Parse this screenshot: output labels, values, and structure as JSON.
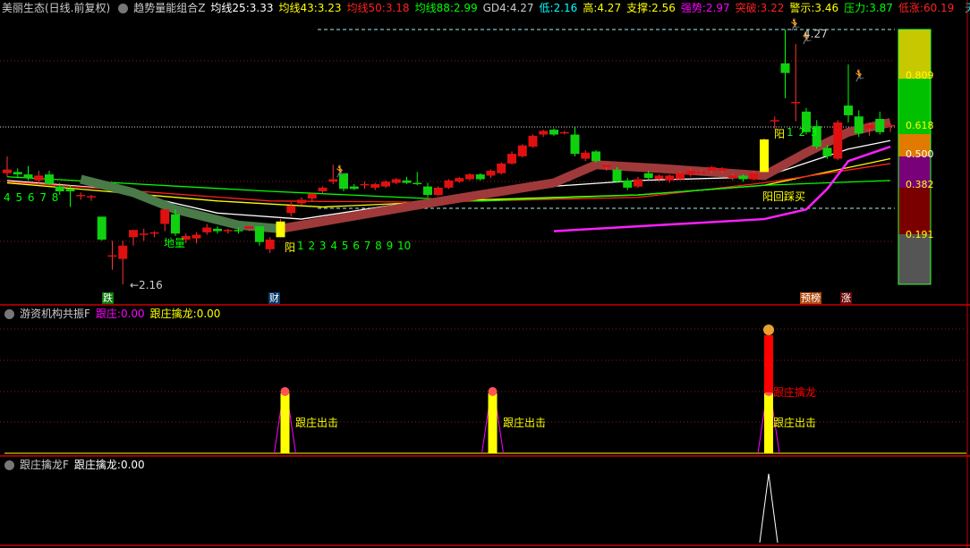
{
  "header": {
    "stock": "美丽生态(日线.前复权)",
    "indicator": "趋势量能组合Z",
    "values": [
      {
        "label": "均线25:",
        "value": "3.33",
        "color": "#ffffff"
      },
      {
        "label": "均线43:",
        "value": "3.23",
        "color": "#ffff00"
      },
      {
        "label": "均线50:",
        "value": "3.18",
        "color": "#ff2020"
      },
      {
        "label": "均线88:",
        "value": "2.99",
        "color": "#00ff00"
      },
      {
        "label": "GD4:",
        "value": "4.27",
        "color": "#cccccc"
      },
      {
        "label": "低:",
        "value": "2.16",
        "color": "#00ffff"
      },
      {
        "label": "高:",
        "value": "4.27",
        "color": "#ffff00"
      },
      {
        "label": "支撑:",
        "value": "2.56",
        "color": "#ffff00"
      },
      {
        "label": "强势:",
        "value": "2.97",
        "color": "#ff00ff"
      },
      {
        "label": "突破:",
        "value": "3.22",
        "color": "#ff2020"
      },
      {
        "label": "警示:",
        "value": "3.46",
        "color": "#ffff00"
      },
      {
        "label": "压力:",
        "value": "3.87",
        "color": "#00ff00"
      },
      {
        "label": "低涨:",
        "value": "60.19",
        "color": "#ff2020"
      }
    ],
    "tail": "天◇"
  },
  "main": {
    "annotations": {
      "high": "4.27",
      "low": "←2.16",
      "diliang": "地量",
      "seq_left": "4 5 6 7 8",
      "yang": "阳",
      "seq_mid": "1 2 3 4 5 6 7 8 9 10",
      "seq_right": "1 2 3",
      "yang_right": "阳",
      "huicai": "阳回踩买"
    },
    "tags": {
      "die": "跌",
      "cai": "财",
      "yubang": "预榜",
      "zhang": "涨"
    },
    "fib_levels": [
      "0.809",
      "0.618",
      "0.500",
      "0.382",
      "0.191"
    ]
  },
  "panel1": {
    "title": "游资机构共振F",
    "v1_label": "跟庄:",
    "v1": "0.00",
    "v2_label": "跟庄擒龙:",
    "v2": "0.00",
    "signal": "跟庄出击",
    "signal2": "跟庄擒龙"
  },
  "panel2": {
    "title": "跟庄擒龙F",
    "v_label": "跟庄擒龙:",
    "v": "0.00"
  },
  "chart_data": {
    "type": "candlestick",
    "ylim": [
      2.16,
      4.27
    ],
    "ohlc": [
      [
        3.08,
        3.22,
        3.05,
        3.11
      ],
      [
        3.09,
        3.12,
        3.04,
        3.07
      ],
      [
        3.07,
        3.14,
        3.02,
        3.04
      ],
      [
        3.02,
        3.1,
        2.99,
        3.06
      ],
      [
        3.07,
        3.1,
        2.98,
        2.99
      ],
      [
        2.97,
        3.0,
        2.9,
        2.93
      ],
      [
        2.95,
        2.98,
        2.8,
        2.93
      ],
      [
        2.9,
        2.92,
        2.86,
        2.9
      ],
      [
        2.88,
        2.9,
        2.85,
        2.89
      ],
      [
        2.72,
        2.72,
        2.52,
        2.53
      ],
      [
        2.39,
        2.52,
        2.28,
        2.4
      ],
      [
        2.37,
        2.52,
        2.16,
        2.48
      ],
      [
        2.55,
        2.6,
        2.48,
        2.61
      ],
      [
        2.58,
        2.62,
        2.52,
        2.58
      ],
      [
        2.58,
        2.6,
        2.55,
        2.59
      ],
      [
        2.66,
        2.77,
        2.6,
        2.78
      ],
      [
        2.74,
        2.78,
        2.56,
        2.58
      ],
      [
        2.53,
        2.58,
        2.5,
        2.56
      ],
      [
        2.54,
        2.59,
        2.5,
        2.57
      ],
      [
        2.59,
        2.66,
        2.57,
        2.63
      ],
      [
        2.62,
        2.64,
        2.58,
        2.6
      ],
      [
        2.6,
        2.62,
        2.58,
        2.61
      ],
      [
        2.61,
        2.63,
        2.58,
        2.6
      ],
      [
        2.62,
        2.65,
        2.6,
        2.64
      ],
      [
        2.64,
        2.64,
        2.48,
        2.51
      ],
      [
        2.45,
        2.55,
        2.42,
        2.53
      ],
      [
        2.55,
        2.7,
        2.55,
        2.68
      ],
      [
        2.75,
        2.84,
        2.72,
        2.81
      ],
      [
        2.83,
        2.88,
        2.82,
        2.86
      ],
      [
        2.87,
        2.92,
        2.85,
        2.91
      ],
      [
        2.93,
        2.97,
        2.91,
        2.96
      ],
      [
        3.01,
        3.15,
        2.99,
        3.03
      ],
      [
        3.08,
        3.08,
        2.93,
        2.95
      ],
      [
        2.97,
        2.99,
        2.94,
        2.95
      ],
      [
        2.99,
        3.01,
        2.95,
        2.99
      ],
      [
        2.96,
        3.0,
        2.94,
        2.99
      ],
      [
        2.97,
        3.02,
        2.96,
        3.01
      ],
      [
        3.0,
        3.04,
        2.99,
        3.03
      ],
      [
        3.02,
        3.05,
        2.99,
        3.0
      ],
      [
        3.0,
        3.09,
        2.98,
        2.99
      ],
      [
        2.97,
        3.0,
        2.88,
        2.9
      ],
      [
        2.9,
        2.97,
        2.89,
        2.96
      ],
      [
        2.96,
        3.03,
        2.95,
        3.02
      ],
      [
        3.01,
        3.05,
        3.0,
        3.04
      ],
      [
        3.03,
        3.08,
        3.02,
        3.07
      ],
      [
        3.07,
        3.08,
        3.02,
        3.03
      ],
      [
        3.06,
        3.11,
        3.04,
        3.1
      ],
      [
        3.08,
        3.17,
        3.07,
        3.16
      ],
      [
        3.16,
        3.26,
        3.15,
        3.24
      ],
      [
        3.22,
        3.32,
        3.21,
        3.31
      ],
      [
        3.3,
        3.4,
        3.29,
        3.39
      ],
      [
        3.4,
        3.44,
        3.38,
        3.43
      ],
      [
        3.44,
        3.45,
        3.39,
        3.4
      ],
      [
        3.42,
        3.43,
        3.4,
        3.42
      ],
      [
        3.4,
        3.46,
        3.22,
        3.24
      ],
      [
        3.2,
        3.27,
        3.18,
        3.25
      ],
      [
        3.26,
        3.27,
        3.17,
        3.18
      ],
      [
        3.13,
        3.16,
        3.1,
        3.15
      ],
      [
        3.11,
        3.13,
        3.0,
        3.01
      ],
      [
        3.02,
        3.04,
        2.94,
        2.96
      ],
      [
        2.97,
        3.05,
        2.96,
        3.03
      ],
      [
        3.08,
        3.1,
        3.02,
        3.04
      ],
      [
        3.03,
        3.07,
        3.01,
        3.06
      ],
      [
        3.02,
        3.07,
        3.0,
        3.06
      ],
      [
        3.03,
        3.1,
        3.02,
        3.08
      ],
      [
        3.07,
        3.12,
        3.05,
        3.1
      ],
      [
        3.09,
        3.11,
        3.07,
        3.09
      ],
      [
        3.1,
        3.14,
        3.08,
        3.13
      ],
      [
        3.1,
        3.13,
        3.08,
        3.12
      ],
      [
        3.04,
        3.08,
        3.02,
        3.06
      ],
      [
        3.06,
        3.07,
        3.01,
        3.03
      ],
      [
        3.03,
        3.1,
        3.02,
        3.08
      ],
      [
        3.09,
        3.37,
        3.08,
        3.36
      ],
      [
        3.52,
        3.55,
        3.45,
        3.52
      ],
      [
        3.99,
        4.27,
        3.7,
        3.91
      ],
      [
        3.66,
        4.15,
        3.51,
        3.67
      ],
      [
        3.59,
        3.62,
        3.4,
        3.42
      ],
      [
        3.47,
        3.52,
        3.28,
        3.3
      ],
      [
        3.29,
        3.31,
        3.2,
        3.22
      ],
      [
        3.2,
        3.52,
        3.19,
        3.5
      ],
      [
        3.64,
        3.98,
        3.5,
        3.56
      ],
      [
        3.55,
        3.6,
        3.38,
        3.41
      ],
      [
        3.45,
        3.5,
        3.39,
        3.48
      ],
      [
        3.53,
        3.59,
        3.4,
        3.42
      ],
      [
        3.47,
        3.49,
        3.42,
        3.48
      ]
    ],
    "signal_bars": [
      26,
      72
    ],
    "lines": [
      {
        "name": "ma25",
        "color": "#ffffff",
        "points": [
          [
            0,
            3.02
          ],
          [
            10,
            2.95
          ],
          [
            20,
            2.75
          ],
          [
            28,
            2.7
          ],
          [
            40,
            2.86
          ],
          [
            50,
            2.96
          ],
          [
            60,
            3.02
          ],
          [
            72,
            3.05
          ],
          [
            80,
            3.28
          ],
          [
            84,
            3.35
          ]
        ]
      },
      {
        "name": "ma43",
        "color": "#ffff00",
        "points": [
          [
            0,
            3.0
          ],
          [
            20,
            2.85
          ],
          [
            30,
            2.8
          ],
          [
            45,
            2.86
          ],
          [
            60,
            2.9
          ],
          [
            72,
            2.98
          ],
          [
            84,
            3.2
          ]
        ]
      },
      {
        "name": "ma50",
        "color": "#ff2020",
        "points": [
          [
            0,
            3.01
          ],
          [
            25,
            2.85
          ],
          [
            40,
            2.84
          ],
          [
            60,
            2.88
          ],
          [
            72,
            3.0
          ],
          [
            84,
            3.16
          ]
        ]
      },
      {
        "name": "ma88",
        "color": "#00ff00",
        "points": [
          [
            0,
            3.05
          ],
          [
            25,
            2.93
          ],
          [
            45,
            2.85
          ],
          [
            60,
            2.9
          ],
          [
            72,
            2.98
          ],
          [
            84,
            3.02
          ]
        ]
      },
      {
        "name": "support",
        "color": "#ff20ff",
        "points": [
          [
            52,
            2.6
          ],
          [
            72,
            2.7
          ],
          [
            76,
            2.78
          ],
          [
            78,
            2.95
          ],
          [
            80,
            3.18
          ],
          [
            84,
            3.3
          ]
        ]
      },
      {
        "name": "ribbon-green",
        "color": "#4a7a48",
        "points": [
          [
            7,
            3.03
          ],
          [
            12,
            2.92
          ],
          [
            16,
            2.78
          ],
          [
            22,
            2.65
          ],
          [
            26,
            2.62
          ]
        ]
      },
      {
        "name": "ribbon-brown",
        "color": "#a03a3a",
        "points": [
          [
            26,
            2.62
          ],
          [
            40,
            2.83
          ],
          [
            52,
            3.0
          ],
          [
            56,
            3.15
          ],
          [
            62,
            3.12
          ],
          [
            72,
            3.06
          ],
          [
            76,
            3.25
          ],
          [
            80,
            3.42
          ],
          [
            84,
            3.5
          ]
        ]
      }
    ],
    "panel1_signals": [
      26,
      46,
      72
    ],
    "panel2_signals": [
      72
    ]
  }
}
